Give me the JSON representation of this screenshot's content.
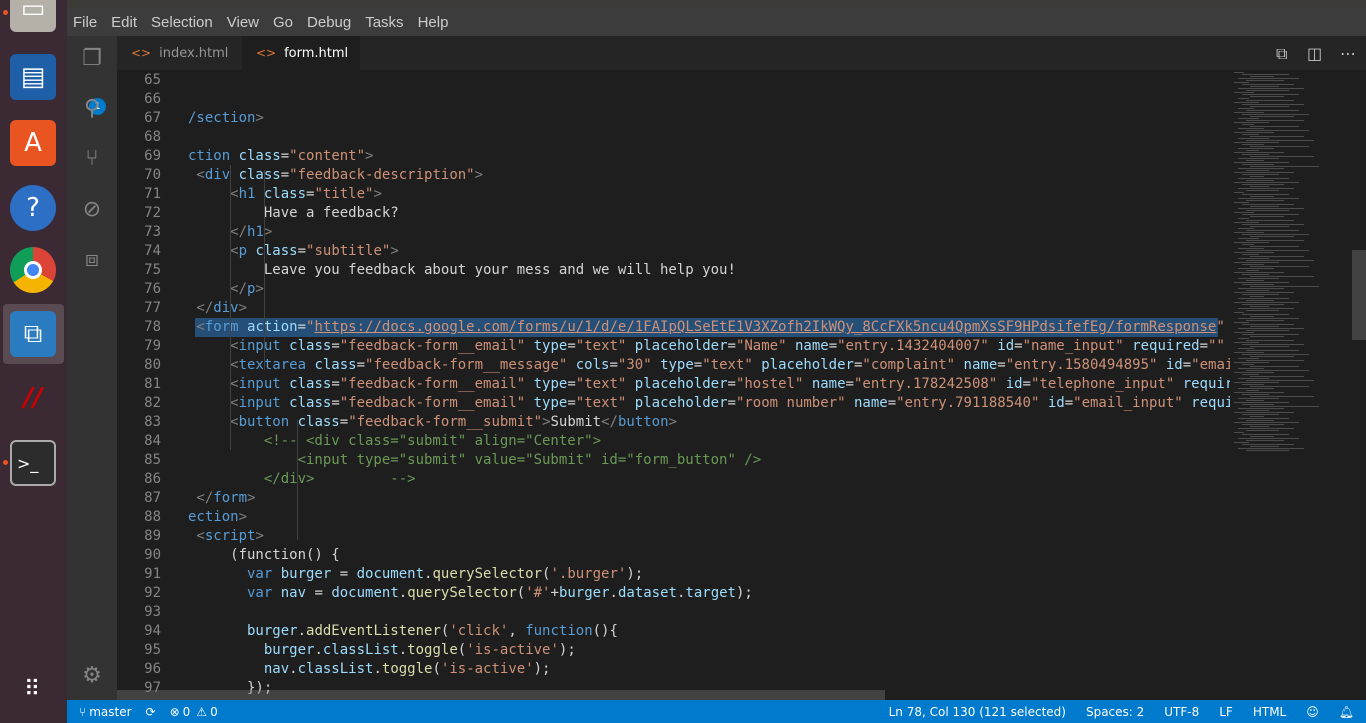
{
  "menu": [
    "File",
    "Edit",
    "Selection",
    "View",
    "Go",
    "Debug",
    "Tasks",
    "Help"
  ],
  "tabs": [
    {
      "label": "index.html",
      "icon": "code-file-icon"
    },
    {
      "label": "form.html",
      "icon": "code-file-icon",
      "modified": true
    }
  ],
  "activity": {
    "explorer_badge": "1"
  },
  "selection": {
    "line": 78
  },
  "lines": [
    [
      65,
      []
    ],
    [
      66,
      []
    ],
    [
      67,
      [
        [
          "t",
          "/section"
        ],
        [
          "g",
          ">"
        ]
      ]
    ],
    [
      68,
      []
    ],
    [
      69,
      [
        [
          "t",
          "ction "
        ],
        [
          "a",
          "class"
        ],
        [
          "p",
          "="
        ],
        [
          "s",
          "\"content\""
        ],
        [
          "g",
          ">"
        ]
      ]
    ],
    [
      70,
      [
        [
          "g",
          " <"
        ],
        [
          "t",
          "div "
        ],
        [
          "a",
          "class"
        ],
        [
          "p",
          "="
        ],
        [
          "s",
          "\"feedback-description\""
        ],
        [
          "g",
          ">"
        ]
      ]
    ],
    [
      71,
      [
        [
          "g",
          "     <"
        ],
        [
          "t",
          "h1 "
        ],
        [
          "a",
          "class"
        ],
        [
          "p",
          "="
        ],
        [
          "s",
          "\"title\""
        ],
        [
          "g",
          ">"
        ]
      ]
    ],
    [
      72,
      [
        [
          "p",
          "         Have a feedback?"
        ]
      ]
    ],
    [
      73,
      [
        [
          "g",
          "     </"
        ],
        [
          "t",
          "h1"
        ],
        [
          "g",
          ">"
        ]
      ]
    ],
    [
      74,
      [
        [
          "g",
          "     <"
        ],
        [
          "t",
          "p "
        ],
        [
          "a",
          "class"
        ],
        [
          "p",
          "="
        ],
        [
          "s",
          "\"subtitle\""
        ],
        [
          "g",
          ">"
        ]
      ]
    ],
    [
      75,
      [
        [
          "p",
          "         Leave you feedback about your mess and we will help you!"
        ]
      ]
    ],
    [
      76,
      [
        [
          "g",
          "     </"
        ],
        [
          "t",
          "p"
        ],
        [
          "g",
          ">"
        ]
      ]
    ],
    [
      77,
      [
        [
          "g",
          " </"
        ],
        [
          "t",
          "div"
        ],
        [
          "g",
          ">"
        ]
      ]
    ],
    [
      78,
      [
        [
          "g",
          " <"
        ],
        [
          "t",
          "form "
        ],
        [
          "a",
          "action"
        ],
        [
          "p",
          "="
        ],
        [
          "s",
          "\""
        ],
        [
          "su",
          "https://docs.google.com/forms/u/1/d/e/1FAIpQLSeEtE1V3XZofh2IkWQy_8CcFXk5ncu4QpmXsSF9HPdsifefEg/formResponse"
        ],
        [
          "s",
          "\""
        ]
      ]
    ],
    [
      79,
      [
        [
          "g",
          "     <"
        ],
        [
          "t",
          "input "
        ],
        [
          "a",
          "class"
        ],
        [
          "p",
          "="
        ],
        [
          "s",
          "\"feedback-form__email\" "
        ],
        [
          "a",
          "type"
        ],
        [
          "p",
          "="
        ],
        [
          "s",
          "\"text\" "
        ],
        [
          "a",
          "placeholder"
        ],
        [
          "p",
          "="
        ],
        [
          "s",
          "\"Name\" "
        ],
        [
          "a",
          "name"
        ],
        [
          "p",
          "="
        ],
        [
          "s",
          "\"entry.1432404007\" "
        ],
        [
          "a",
          "id"
        ],
        [
          "p",
          "="
        ],
        [
          "s",
          "\"name_input\" "
        ],
        [
          "a",
          "required"
        ],
        [
          "p",
          "="
        ],
        [
          "s",
          "\"\""
        ]
      ]
    ],
    [
      80,
      [
        [
          "g",
          "     <"
        ],
        [
          "t",
          "textarea "
        ],
        [
          "a",
          "class"
        ],
        [
          "p",
          "="
        ],
        [
          "s",
          "\"feedback-form__message\" "
        ],
        [
          "a",
          "cols"
        ],
        [
          "p",
          "="
        ],
        [
          "s",
          "\"30\" "
        ],
        [
          "a",
          "type"
        ],
        [
          "p",
          "="
        ],
        [
          "s",
          "\"text\" "
        ],
        [
          "a",
          "placeholder"
        ],
        [
          "p",
          "="
        ],
        [
          "s",
          "\"complaint\" "
        ],
        [
          "a",
          "name"
        ],
        [
          "p",
          "="
        ],
        [
          "s",
          "\"entry.1580494895\" "
        ],
        [
          "a",
          "id"
        ],
        [
          "p",
          "="
        ],
        [
          "s",
          "\"emai"
        ]
      ]
    ],
    [
      81,
      [
        [
          "g",
          "     <"
        ],
        [
          "t",
          "input "
        ],
        [
          "a",
          "class"
        ],
        [
          "p",
          "="
        ],
        [
          "s",
          "\"feedback-form__email\" "
        ],
        [
          "a",
          "type"
        ],
        [
          "p",
          "="
        ],
        [
          "s",
          "\"text\" "
        ],
        [
          "a",
          "placeholder"
        ],
        [
          "p",
          "="
        ],
        [
          "s",
          "\"hostel\" "
        ],
        [
          "a",
          "name"
        ],
        [
          "p",
          "="
        ],
        [
          "s",
          "\"entry.178242508\" "
        ],
        [
          "a",
          "id"
        ],
        [
          "p",
          "="
        ],
        [
          "s",
          "\"telephone_input\" "
        ],
        [
          "a",
          "requir"
        ]
      ]
    ],
    [
      82,
      [
        [
          "g",
          "     <"
        ],
        [
          "t",
          "input "
        ],
        [
          "a",
          "class"
        ],
        [
          "p",
          "="
        ],
        [
          "s",
          "\"feedback-form__email\" "
        ],
        [
          "a",
          "type"
        ],
        [
          "p",
          "="
        ],
        [
          "s",
          "\"text\" "
        ],
        [
          "a",
          "placeholder"
        ],
        [
          "p",
          "="
        ],
        [
          "s",
          "\"room number\" "
        ],
        [
          "a",
          "name"
        ],
        [
          "p",
          "="
        ],
        [
          "s",
          "\"entry.791188540\" "
        ],
        [
          "a",
          "id"
        ],
        [
          "p",
          "="
        ],
        [
          "s",
          "\"email_input\" "
        ],
        [
          "a",
          "requi"
        ]
      ]
    ],
    [
      83,
      [
        [
          "g",
          "     <"
        ],
        [
          "t",
          "button "
        ],
        [
          "a",
          "class"
        ],
        [
          "p",
          "="
        ],
        [
          "s",
          "\"feedback-form__submit\""
        ],
        [
          "g",
          ">"
        ],
        [
          "p",
          "Submit"
        ],
        [
          "g",
          "</"
        ],
        [
          "t",
          "button"
        ],
        [
          "g",
          ">"
        ]
      ]
    ],
    [
      84,
      [
        [
          "c",
          "         <!-- <div class=\"submit\" align=\"Center\">"
        ]
      ]
    ],
    [
      85,
      [
        [
          "c",
          "             <input type=\"submit\" value=\"Submit\" id=\"form_button\" />"
        ]
      ]
    ],
    [
      86,
      [
        [
          "c",
          "         </div>         -->"
        ]
      ]
    ],
    [
      87,
      [
        [
          "g",
          " </"
        ],
        [
          "t",
          "form"
        ],
        [
          "g",
          ">"
        ]
      ]
    ],
    [
      88,
      [
        [
          "t",
          "ection"
        ],
        [
          "g",
          ">"
        ]
      ]
    ],
    [
      89,
      [
        [
          "g",
          " <"
        ],
        [
          "t",
          "script"
        ],
        [
          "g",
          ">"
        ]
      ]
    ],
    [
      90,
      [
        [
          "p",
          "     (function() {"
        ]
      ]
    ],
    [
      91,
      [
        [
          "t",
          "       var "
        ],
        [
          "a",
          "burger"
        ],
        [
          "p",
          " = "
        ],
        [
          "a",
          "document"
        ],
        [
          "p",
          "."
        ],
        [
          "f",
          "querySelector"
        ],
        [
          "p",
          "("
        ],
        [
          "s",
          "'.burger'"
        ],
        [
          "p",
          ");"
        ]
      ]
    ],
    [
      92,
      [
        [
          "t",
          "       var "
        ],
        [
          "a",
          "nav"
        ],
        [
          "p",
          " = "
        ],
        [
          "a",
          "document"
        ],
        [
          "p",
          "."
        ],
        [
          "f",
          "querySelector"
        ],
        [
          "p",
          "("
        ],
        [
          "s",
          "'#'"
        ],
        [
          "p",
          "+"
        ],
        [
          "a",
          "burger"
        ],
        [
          "p",
          "."
        ],
        [
          "a",
          "dataset"
        ],
        [
          "p",
          "."
        ],
        [
          "a",
          "target"
        ],
        [
          "p",
          ");"
        ]
      ]
    ],
    [
      93,
      []
    ],
    [
      94,
      [
        [
          "a",
          "       burger"
        ],
        [
          "p",
          "."
        ],
        [
          "f",
          "addEventListener"
        ],
        [
          "p",
          "("
        ],
        [
          "s",
          "'click'"
        ],
        [
          "p",
          ", "
        ],
        [
          "t",
          "function"
        ],
        [
          "p",
          "(){"
        ]
      ]
    ],
    [
      95,
      [
        [
          "a",
          "         burger"
        ],
        [
          "p",
          "."
        ],
        [
          "a",
          "classList"
        ],
        [
          "p",
          "."
        ],
        [
          "f",
          "toggle"
        ],
        [
          "p",
          "("
        ],
        [
          "s",
          "'is-active'"
        ],
        [
          "p",
          ");"
        ]
      ]
    ],
    [
      96,
      [
        [
          "a",
          "         nav"
        ],
        [
          "p",
          "."
        ],
        [
          "a",
          "classList"
        ],
        [
          "p",
          "."
        ],
        [
          "f",
          "toggle"
        ],
        [
          "p",
          "("
        ],
        [
          "s",
          "'is-active'"
        ],
        [
          "p",
          ");"
        ]
      ]
    ],
    [
      97,
      [
        [
          "p",
          "       });"
        ]
      ]
    ]
  ],
  "status": {
    "branch": "master",
    "errors": "0",
    "warnings": "0",
    "position": "Ln 78, Col 130 (121 selected)",
    "spaces": "Spaces: 2",
    "encoding": "UTF-8",
    "eol": "LF",
    "language": "HTML"
  }
}
